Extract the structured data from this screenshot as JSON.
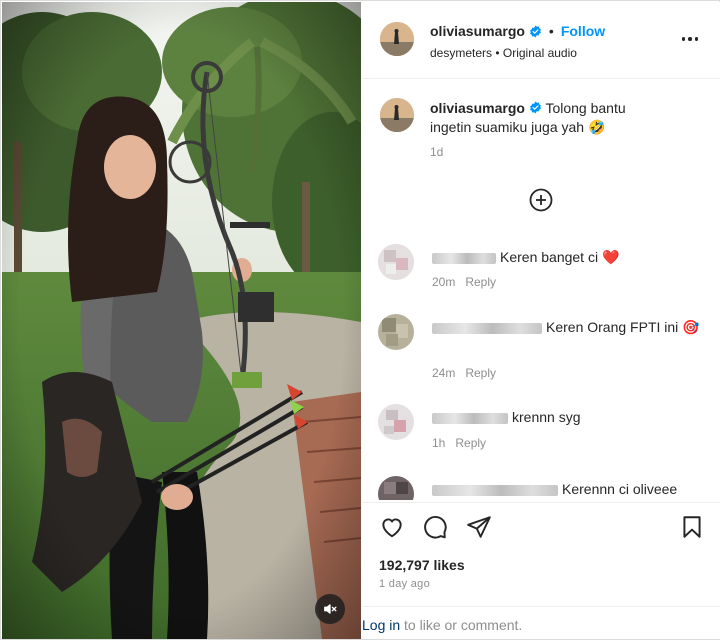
{
  "post": {
    "username": "oliviasumargo",
    "follow_label": "Follow",
    "separator": "•",
    "audio_text": "desymeters • Original audio",
    "caption_text": "Tolong bantu ingetin suamiku juga yah 🤣",
    "caption_time": "1d"
  },
  "comments": [
    {
      "text": "Keren banget ci ❤️",
      "time": "20m",
      "reply_label": "Reply"
    },
    {
      "text": "Keren Orang FPTI ini 🎯",
      "time": "24m",
      "reply_label": "Reply"
    },
    {
      "text": "krennn syg",
      "time": "1h",
      "reply_label": "Reply"
    },
    {
      "text": "Kerennn ci oliveee",
      "time": "",
      "reply_label": ""
    }
  ],
  "engagement": {
    "likes": "192,797 likes",
    "date": "1 day ago"
  },
  "login_bar": {
    "link": "Log in",
    "rest": " to like or comment."
  },
  "icons": {
    "verified": "verified-badge-icon",
    "more": "more-options-icon",
    "load_more": "plus-circle-icon",
    "like": "heart-icon",
    "comment": "comment-icon",
    "share": "share-icon",
    "save": "bookmark-icon",
    "mute": "speaker-muted-icon"
  },
  "colors": {
    "accent": "#0095f6",
    "link": "#00376b",
    "muted_text": "#8e8e8e"
  }
}
